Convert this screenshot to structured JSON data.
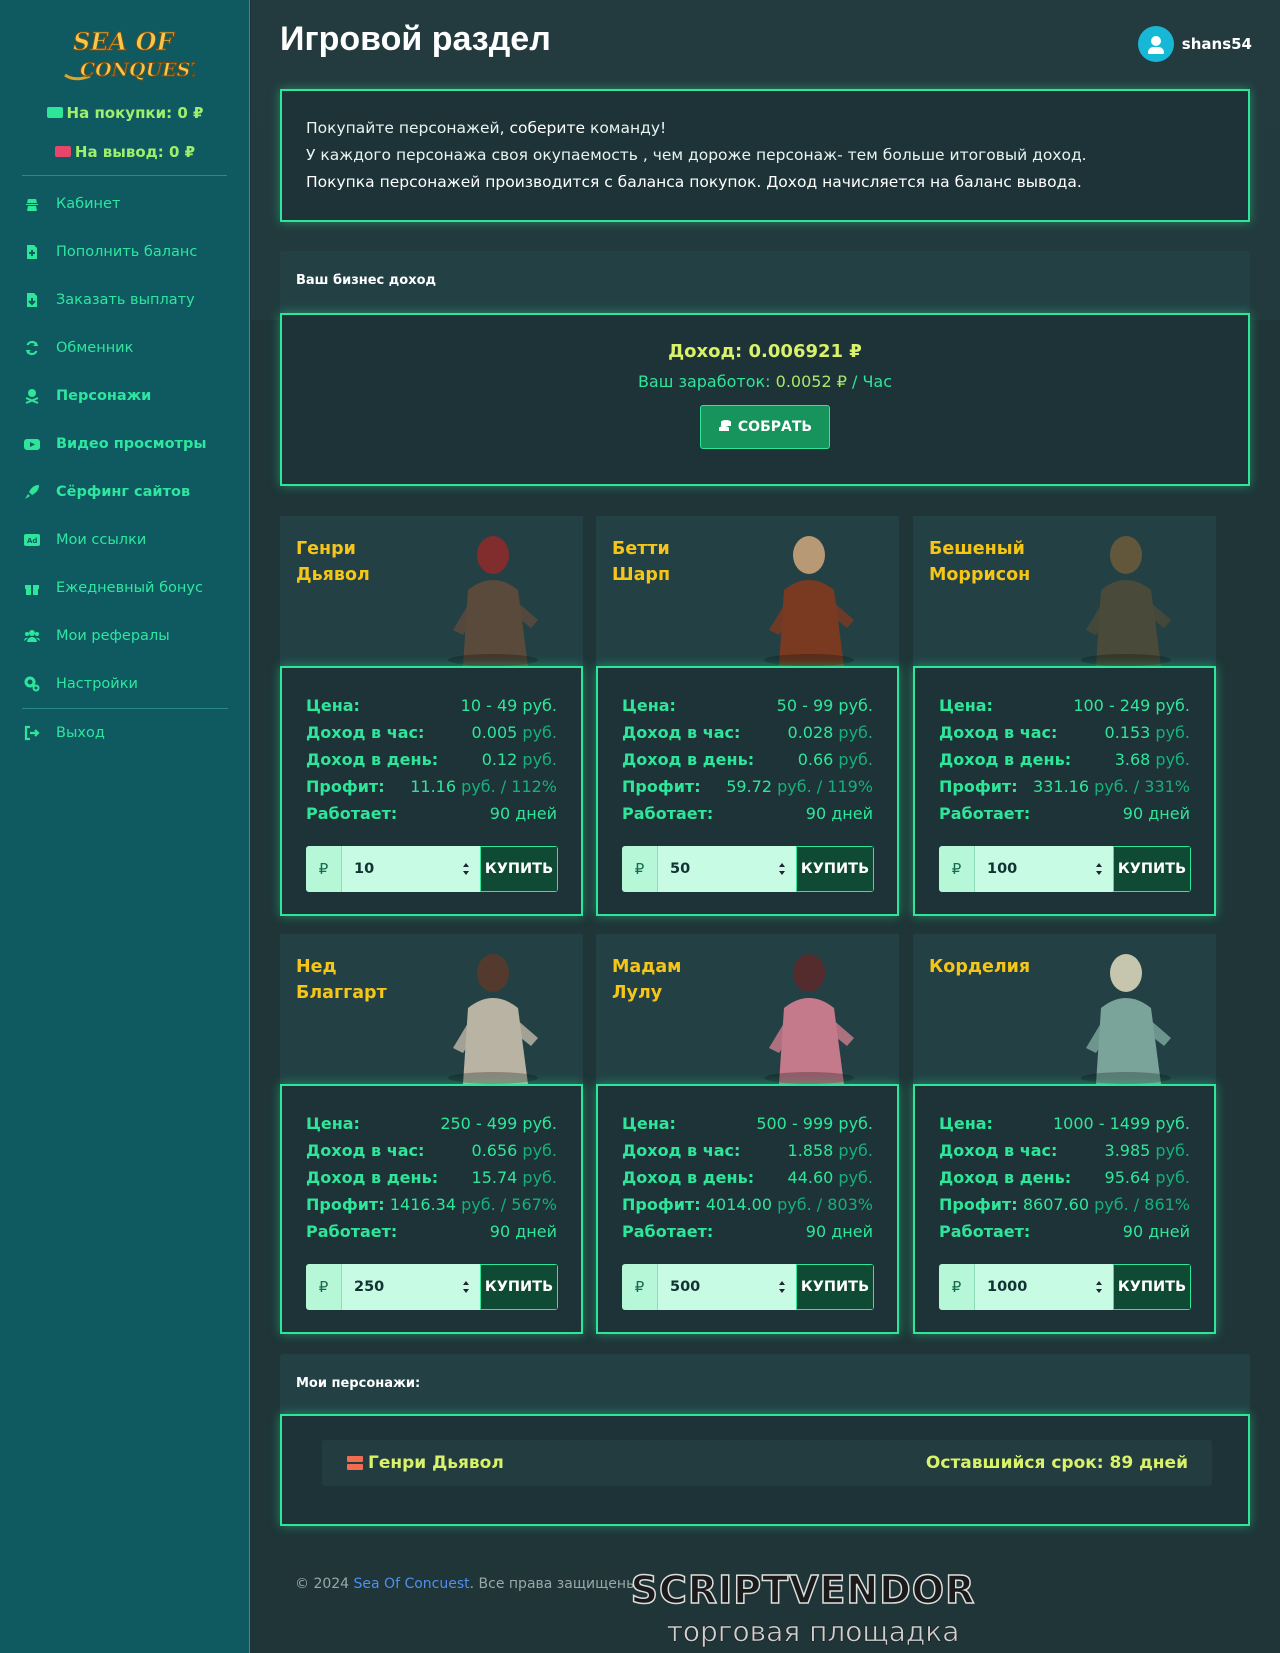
{
  "sidebar": {
    "logo_line1": "SEA OF",
    "logo_line2": "CONQUEST",
    "balance_buy": "На покупки: 0 ₽",
    "balance_out": "На вывод: 0 ₽",
    "items": [
      {
        "label": "Кабинет",
        "icon": "user-secret-icon"
      },
      {
        "label": "Пополнить баланс",
        "icon": "file-plus-icon"
      },
      {
        "label": "Заказать выплату",
        "icon": "file-download-icon"
      },
      {
        "label": "Обменник",
        "icon": "refresh-icon"
      },
      {
        "label": "Персонажи",
        "icon": "skull-crossbones-icon"
      },
      {
        "label": "Видео просмотры",
        "icon": "youtube-icon"
      },
      {
        "label": "Сёрфинг сайтов",
        "icon": "rocket-icon"
      },
      {
        "label": "Мои ссылки",
        "icon": "ad-icon"
      },
      {
        "label": "Ежедневный бонус",
        "icon": "gift-icon"
      },
      {
        "label": "Мои рефералы",
        "icon": "users-icon"
      },
      {
        "label": "Настройки",
        "icon": "cogs-icon"
      },
      {
        "label": "Выход",
        "icon": "sign-out-icon"
      }
    ]
  },
  "header": {
    "title": "Игровой раздел",
    "username": "shans54"
  },
  "info": {
    "line1_a": "Покупайте персонажей, ",
    "line1_b": "соберите",
    "line1_c": " команду!",
    "line2": "У каждого персонажа своя окупаемость , чем дороже персонаж- тем больше итоговый доход.",
    "line3": "Покупка персонажей производится с баланса покупок. Доход начисляется на баланс вывода."
  },
  "business": {
    "head": "Ваш бизнес доход",
    "income_label": "Доход: ",
    "income_value": "0.006921 ₽",
    "earn_label": "Ваш заработок: ",
    "earn_value": "0.0052 ₽",
    "earn_unit": " / Час",
    "collect_label": "СОБРАТЬ"
  },
  "labels": {
    "price": "Цена:",
    "per_hour": "Доход в час:",
    "per_day": "Доход в день:",
    "profit": "Профит:",
    "works": "Работает:",
    "rub_unit": "руб.",
    "rub_sign": "₽",
    "buy": "КУПИТЬ"
  },
  "characters": [
    {
      "name1": "Генри",
      "name2": "Дьявол",
      "price": "10 - 49 руб.",
      "hour": "0.005",
      "day": "0.12",
      "profit_val": "11.16",
      "profit_pct": "/ 112%",
      "works": "90 дней",
      "qty": "10"
    },
    {
      "name1": "Бетти",
      "name2": "Шарп",
      "price": "50 - 99 руб.",
      "hour": "0.028",
      "day": "0.66",
      "profit_val": "59.72",
      "profit_pct": "/ 119%",
      "works": "90 дней",
      "qty": "50"
    },
    {
      "name1": "Бешеный",
      "name2": "Моррисон",
      "price": "100 - 249 руб.",
      "hour": "0.153",
      "day": "3.68",
      "profit_val": "331.16",
      "profit_pct": "/ 331%",
      "works": "90 дней",
      "qty": "100"
    },
    {
      "name1": "Нед",
      "name2": "Благгарт",
      "price": "250 - 499 руб.",
      "hour": "0.656",
      "day": "15.74",
      "profit_val": "1416.34",
      "profit_pct": "/ 567%",
      "works": "90 дней",
      "qty": "250"
    },
    {
      "name1": "Мадам",
      "name2": "Лулу",
      "price": "500 - 999 руб.",
      "hour": "1.858",
      "day": "44.60",
      "profit_val": "4014.00",
      "profit_pct": "/ 803%",
      "works": "90 дней",
      "qty": "500"
    },
    {
      "name1": "Корделия",
      "name2": "",
      "price": "1000 - 1499 руб.",
      "hour": "3.985",
      "day": "95.64",
      "profit_val": "8607.60",
      "profit_pct": "/ 861%",
      "works": "90 дней",
      "qty": "1000"
    }
  ],
  "my_characters": {
    "head": "Мои персонажи:",
    "items": [
      {
        "name": "Генри Дьявол",
        "term": "Оставшийся срок: 89 дней"
      }
    ]
  },
  "footer": {
    "copy": "© 2024 ",
    "link": "Sea Of Concuest",
    "rest": ". Все права защищены."
  },
  "watermark": {
    "line1": "SCRIPTVENDOR",
    "line2": "торговая площадка"
  },
  "colors": {
    "accent": "#2ee69a",
    "gold": "#f5c518",
    "sidebar": "#0f5a60",
    "lime": "#d9f26a"
  }
}
